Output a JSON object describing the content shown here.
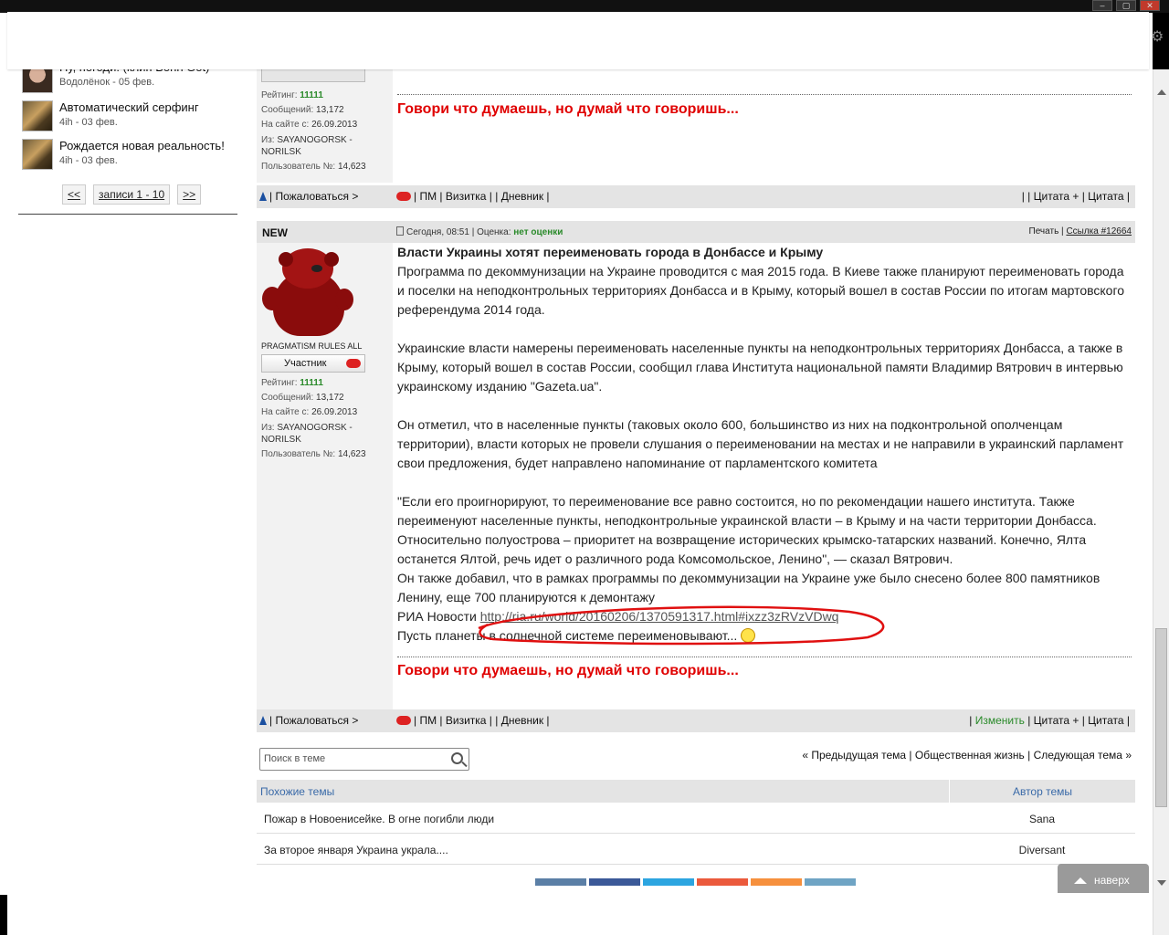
{
  "browser": {
    "window_buttons": [
      "–",
      "▢",
      "✕"
    ]
  },
  "sidebar": {
    "items": [
      {
        "title": "Ну, погоди! (клип Bonn Got)",
        "meta": "Водолёнок - 05 фев.",
        "avatar": "girl-avatar"
      },
      {
        "title": "Автоматический серфинг",
        "meta": "4ih - 03 фев.",
        "avatar": "wolf-avatar"
      },
      {
        "title": "Рождается новая реальность!",
        "meta": "4ih - 03 фев.",
        "avatar": "wolf-avatar"
      }
    ],
    "pager": {
      "prev": "<<",
      "label": "записи 1 - 10",
      "next": ">>"
    }
  },
  "post1": {
    "stats": {
      "rating_label": "Рейтинг:",
      "rating": "11111",
      "messages_label": "Сообщений:",
      "messages": "13,172",
      "since_label": "На сайте с:",
      "since": "26.09.2013",
      "from_label": "Из:",
      "from": "SAYANOGORSK - NORILSK",
      "user_no_label": "Пользователь №:",
      "user_no": "14,623"
    },
    "signature": "Говори что думаешь, но думай что говоришь...",
    "actions": {
      "complain": "| Пожаловаться >",
      "middle": "| ПМ | Визитка | | Дневник |",
      "right": "| | Цитата + | Цитата |"
    }
  },
  "post2": {
    "header": {
      "new_label": "NEW",
      "date": "Сегодня, 08:51",
      "rating_label": "| Оценка:",
      "rating": "нет оценки",
      "print": "Печать",
      "link": "Ссылка #12664"
    },
    "author": {
      "name": "PRAGMATISM RULES ALL",
      "badge": "Участник"
    },
    "stats": {
      "rating_label": "Рейтинг:",
      "rating": "11111",
      "messages_label": "Сообщений:",
      "messages": "13,172",
      "since_label": "На сайте с:",
      "since": "26.09.2013",
      "from_label": "Из:",
      "from": "SAYANOGORSK - NORILSK",
      "user_no_label": "Пользователь №:",
      "user_no": "14,623"
    },
    "title": "Власти Украины хотят переименовать города в Донбассе и Крыму",
    "paragraphs": [
      "Программа по декоммунизации на Украине проводится с мая 2015 года. В Киеве также планируют переименовать города и поселки на неподконтрольных территориях Донбасса и в Крыму, который вошел в состав России по итогам мартовского референдума 2014 года.",
      "Украинские власти намерены переименовать населенные пункты на неподконтрольных территориях Донбасса, а также в Крыму, который вошел в состав России, сообщил глава Института национальной памяти Владимир Вятрович в интервью украинскому изданию \"Gazeta.ua\".",
      "Он отметил, что в населенные пункты (таковых около 600, большинство из них на подконтрольной ополченцам территории), власти которых не провели слушания о переименовании на местах и не направили в украинский парламент свои предложения, будет направлено напоминание от парламентского комитета",
      "\"Если его проигнорируют, то переименование все равно состоится, но по рекомендации нашего института. Также переименуют населенные пункты, неподконтрольные украинской власти – в Крыму и на части территории Донбасса. Относительно полуострова – приоритет на возвращение исторических крымско-татарских названий. Конечно, Ялта останется Ялтой, речь идет о различного рода Комсомольское, Ленино\", — сказал Вятрович.",
      "Он также добавил, что в рамках программы по декоммунизации на Украине уже было снесено более 800 памятников Ленину, еще 700 планируются к демонтажу"
    ],
    "source_label": "РИА Новости",
    "source_link": "http://ria.ru/world/20160206/1370591317.html#ixzz3zRVzVDwq",
    "closing": "Пусть планеты в солнечной системе переименовывают...",
    "signature": "Говори что думаешь, но думай что говоришь...",
    "actions": {
      "complain": "| Пожаловаться >",
      "middle": "| ПМ | Визитка | | Дневник |",
      "edit": "Изменить",
      "right": "| Цитата + | Цитата |"
    }
  },
  "search": {
    "placeholder": "Поиск в теме"
  },
  "topic_nav": {
    "prev": "« Предыдущая тема",
    "section": "Общественная жизнь",
    "next": "Следующая тема »"
  },
  "similar": {
    "col_topic": "Похожие темы",
    "col_author": "Автор темы",
    "rows": [
      {
        "topic": "Пожар в Новоенисейке. В огне погибли люди",
        "author": "Sana"
      },
      {
        "topic": "За второе января Украина украла....",
        "author": "Diversant"
      }
    ]
  },
  "to_top": "наверх",
  "colors": {
    "signature": "#e00000",
    "green": "#2a8a2a",
    "link_blue": "#3a6aa8",
    "share": [
      "#5b7fa6",
      "#3b5998",
      "#2ca5e0",
      "#eb5a3c",
      "#f6903d",
      "#6fa4c4"
    ]
  }
}
